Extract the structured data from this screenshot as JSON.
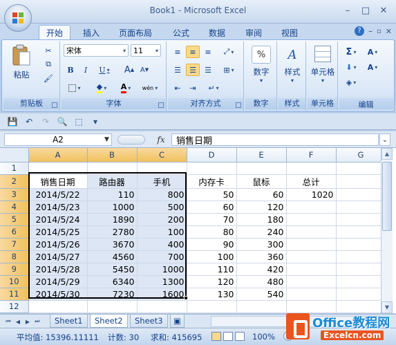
{
  "window": {
    "title": "Book1 - Microsoft Excel"
  },
  "tabs": [
    {
      "label": "开始",
      "active": true
    },
    {
      "label": "插入"
    },
    {
      "label": "页面布局"
    },
    {
      "label": "公式"
    },
    {
      "label": "数据"
    },
    {
      "label": "审阅"
    },
    {
      "label": "视图"
    }
  ],
  "ribbon": {
    "clipboard": {
      "label": "剪贴板",
      "paste_label": "粘贴"
    },
    "font": {
      "label": "字体",
      "font_name": "宋体",
      "font_size": "11",
      "bold": "B",
      "italic": "I",
      "underline": "U",
      "grow": "A",
      "shrink": "A",
      "font_color_letter": "A",
      "phonetic": "wén"
    },
    "alignment": {
      "label": "对齐方式"
    },
    "number": {
      "label": "数字",
      "icon_text": "%"
    },
    "styles": {
      "label": "样式",
      "icon_text": "A"
    },
    "cells": {
      "label": "单元格"
    },
    "editing": {
      "label": "编辑",
      "sum_icon": "Σ",
      "sort_icon": "A",
      "find_icon": "A"
    },
    "edit_group_label": "编辑"
  },
  "formula_bar": {
    "name_box": "A2",
    "fx": "fx",
    "content": "销售日期"
  },
  "columns": [
    "A",
    "B",
    "C",
    "D",
    "E",
    "F",
    "G"
  ],
  "rows": [
    {
      "n": "1",
      "cells": [
        "",
        "",
        "",
        "",
        "",
        "",
        ""
      ]
    },
    {
      "n": "2",
      "cells": [
        "销售日期",
        "路由器",
        "手机",
        "内存卡",
        "鼠标",
        "总计",
        ""
      ]
    },
    {
      "n": "3",
      "cells": [
        "2014/5/22",
        "110",
        "800",
        "50",
        "60",
        "1020",
        ""
      ]
    },
    {
      "n": "4",
      "cells": [
        "2014/5/23",
        "1000",
        "500",
        "60",
        "120",
        "",
        ""
      ]
    },
    {
      "n": "5",
      "cells": [
        "2014/5/24",
        "1890",
        "200",
        "70",
        "180",
        "",
        ""
      ]
    },
    {
      "n": "6",
      "cells": [
        "2014/5/25",
        "2780",
        "100",
        "80",
        "240",
        "",
        ""
      ]
    },
    {
      "n": "7",
      "cells": [
        "2014/5/26",
        "3670",
        "400",
        "90",
        "300",
        "",
        ""
      ]
    },
    {
      "n": "8",
      "cells": [
        "2014/5/27",
        "4560",
        "700",
        "100",
        "360",
        "",
        ""
      ]
    },
    {
      "n": "9",
      "cells": [
        "2014/5/28",
        "5450",
        "1000",
        "110",
        "420",
        "",
        ""
      ]
    },
    {
      "n": "10",
      "cells": [
        "2014/5/29",
        "6340",
        "1300",
        "120",
        "480",
        "",
        ""
      ]
    },
    {
      "n": "11",
      "cells": [
        "2014/5/30",
        "7230",
        "1600",
        "130",
        "540",
        "",
        ""
      ]
    },
    {
      "n": "12",
      "cells": [
        "",
        "",
        "",
        "",
        "",
        "",
        ""
      ]
    }
  ],
  "sheets": [
    {
      "label": "Sheet1"
    },
    {
      "label": "Sheet2",
      "active": true
    },
    {
      "label": "Sheet3"
    }
  ],
  "status": {
    "average": "平均值: 15396.11111",
    "count": "计数: 30",
    "sum": "求和: 415695",
    "zoom": "100%"
  },
  "watermark": {
    "line1": "Office教程网",
    "line2": "Excelcn.com"
  },
  "colors": {
    "selection": "#dce6f4",
    "header_selected": "#f1c15f",
    "ribbon_bg": "#dbe8f7"
  }
}
